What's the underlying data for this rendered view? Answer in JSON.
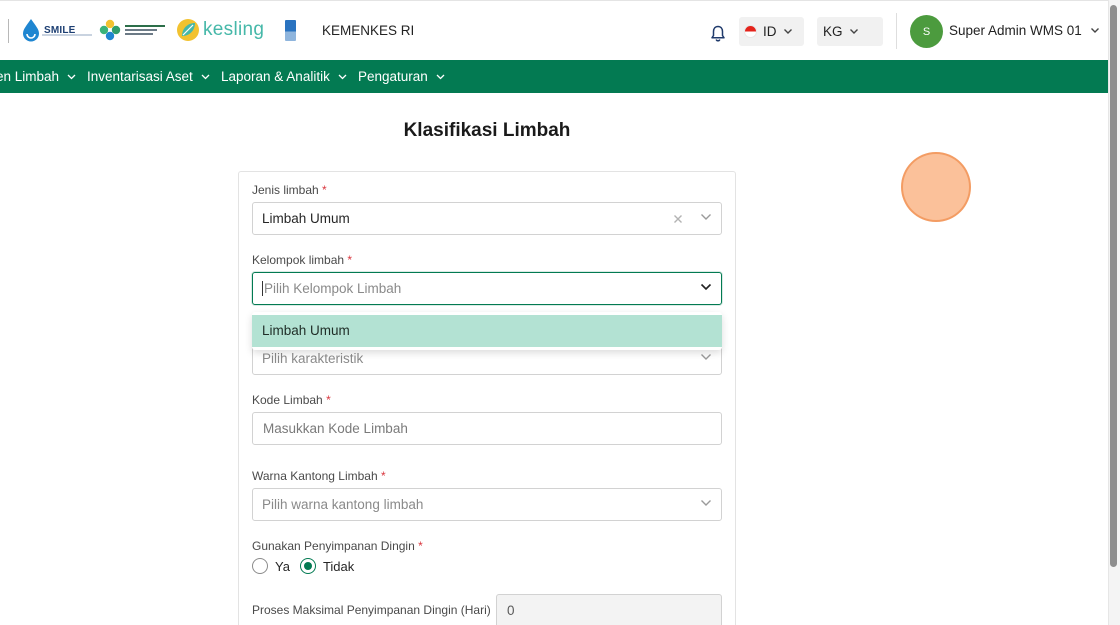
{
  "header": {
    "brand_smile": "SMILE",
    "brand_kesling": "kesling",
    "app_name": "KEMENKES RI",
    "language": "ID",
    "unit": "KG",
    "avatar_initial": "S",
    "user_name": "Super Admin WMS 01"
  },
  "nav": {
    "items": [
      {
        "label": "en Limbah"
      },
      {
        "label": "Inventarisasi Aset"
      },
      {
        "label": "Laporan & Analitik"
      },
      {
        "label": "Pengaturan"
      }
    ]
  },
  "page": {
    "title": "Klasifikasi Limbah"
  },
  "form": {
    "jenis_limbah": {
      "label": "Jenis limbah",
      "required": "*",
      "value": "Limbah Umum"
    },
    "kelompok_limbah": {
      "label": "Kelompok limbah",
      "required": "*",
      "placeholder": "Pilih Kelompok Limbah",
      "options": [
        "Limbah Umum"
      ]
    },
    "karakteristik": {
      "placeholder": "Pilih karakteristik"
    },
    "kode_limbah": {
      "label": "Kode Limbah",
      "required": "*",
      "placeholder": "Masukkan Kode Limbah"
    },
    "warna_kantong": {
      "label": "Warna Kantong Limbah",
      "required": "*",
      "placeholder": "Pilih warna kantong limbah"
    },
    "penyimpanan_dingin": {
      "label": "Gunakan Penyimpanan Dingin",
      "required": "*",
      "options": [
        {
          "label": "Ya",
          "checked": false
        },
        {
          "label": "Tidak",
          "checked": true
        }
      ]
    },
    "proses_maksimal": {
      "label": "Proses Maksimal Penyimpanan Dingin (Hari)",
      "value": "0"
    }
  },
  "colors": {
    "brand_green": "#037a52",
    "option_highlight": "#b3e2d3",
    "avatar_green": "#4c9b3e",
    "required_red": "#d9363e"
  }
}
